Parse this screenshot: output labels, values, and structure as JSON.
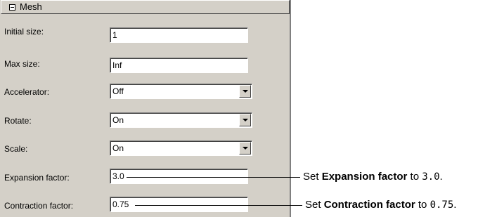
{
  "section": {
    "title": "Mesh"
  },
  "rows": {
    "initial_size": {
      "label": "Initial size:",
      "value": "1"
    },
    "max_size": {
      "label": "Max size:",
      "value": "Inf"
    },
    "accelerator": {
      "label": "Accelerator:",
      "value": "Off"
    },
    "rotate": {
      "label": "Rotate:",
      "value": "On"
    },
    "scale": {
      "label": "Scale:",
      "value": "On"
    },
    "expansion": {
      "label": "Expansion factor:",
      "value": "3.0"
    },
    "contraction": {
      "label": "Contraction factor:",
      "value": "0.75"
    }
  },
  "callouts": {
    "expansion": {
      "prefix": "Set ",
      "bold": "Expansion factor",
      "mid": " to ",
      "code": "3.0",
      "suffix": "."
    },
    "contraction": {
      "prefix": "Set ",
      "bold": "Contraction factor",
      "mid": " to ",
      "code": "0.75",
      "suffix": "."
    }
  },
  "icons": {
    "collapse": "minus-box-icon",
    "dropdown": "chevron-down-icon"
  },
  "colors": {
    "panel_bg": "#d4d0c8",
    "field_bg": "#ffffff"
  }
}
